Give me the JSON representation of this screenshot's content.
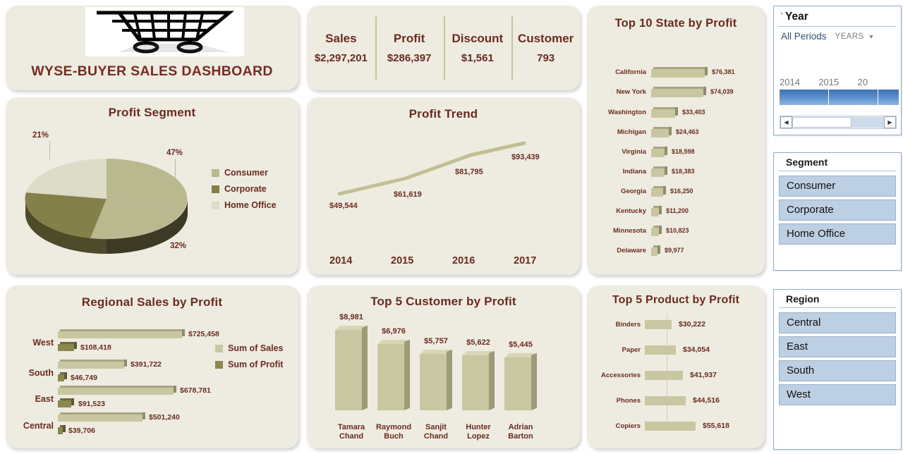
{
  "title_card": {
    "logo_icon": "shopping-cart-icon",
    "heading": "WYSE-BUYER SALES DASHBOARD"
  },
  "kpis": [
    {
      "label": "Sales",
      "value": "$2,297,201"
    },
    {
      "label": "Profit",
      "value": "$286,397"
    },
    {
      "label": "Discount",
      "value": "$1,561"
    },
    {
      "label": "Customer",
      "value": "793"
    }
  ],
  "colors": {
    "card_bg": "#eeece0",
    "title_text": "#6b2a22",
    "sales_series": "#c9c6a2",
    "profit_series": "#8a8750",
    "pie_consumer": "#b9b88f",
    "pie_corporate": "#84804a",
    "pie_home_office": "#dddcc9",
    "slicer_item": "#bdcfe3",
    "timeline_block": "#3f72b4"
  },
  "pie_card": {
    "title": "Profit Segment",
    "labels": [
      "47%",
      "32%",
      "21%"
    ],
    "legend": [
      "Consumer",
      "Corporate",
      "Home Office"
    ]
  },
  "trend_card": {
    "title": "Profit Trend",
    "x_labels": [
      "2014",
      "2015",
      "2016",
      "2017"
    ],
    "point_labels": [
      "$49,544",
      "$61,619",
      "$81,795",
      "$93,439"
    ]
  },
  "state_card": {
    "title": "Top 10 State by Profit",
    "rows": [
      {
        "name": "California",
        "value": "$76,381"
      },
      {
        "name": "New York",
        "value": "$74,039"
      },
      {
        "name": "Washington",
        "value": "$33,403"
      },
      {
        "name": "Michigan",
        "value": "$24,463"
      },
      {
        "name": "Virginia",
        "value": "$18,598"
      },
      {
        "name": "Indiana",
        "value": "$18,383"
      },
      {
        "name": "Georgia",
        "value": "$16,250"
      },
      {
        "name": "Kentucky",
        "value": "$11,200"
      },
      {
        "name": "Minnesota",
        "value": "$10,823"
      },
      {
        "name": "Delaware",
        "value": "$9,977"
      }
    ]
  },
  "region_card": {
    "title": "Regional Sales by Profit",
    "legend": [
      "Sum of Sales",
      "Sum of Profit"
    ],
    "rows": [
      {
        "name": "West",
        "sales": "$725,458",
        "profit": "$108,418"
      },
      {
        "name": "South",
        "sales": "$391,722",
        "profit": "$46,749"
      },
      {
        "name": "East",
        "sales": "$678,781",
        "profit": "$91,523"
      },
      {
        "name": "Central",
        "sales": "$501,240",
        "profit": "$39,706"
      }
    ]
  },
  "customer_card": {
    "title": "Top 5 Customer by Profit",
    "rows": [
      {
        "name1": "Tamara",
        "name2": "Chand",
        "value": "$8,981"
      },
      {
        "name1": "Raymond",
        "name2": "Buch",
        "value": "$6,976"
      },
      {
        "name1": "Sanjit",
        "name2": "Chand",
        "value": "$5,757"
      },
      {
        "name1": "Hunter",
        "name2": "Lopez",
        "value": "$5,622"
      },
      {
        "name1": "Adrian",
        "name2": "Barton",
        "value": "$5,445"
      }
    ]
  },
  "product_card": {
    "title": "Top 5 Product by Profit",
    "rows": [
      {
        "name": "Binders",
        "value": "$30,222"
      },
      {
        "name": "Paper",
        "value": "$34,054"
      },
      {
        "name": "Accessories",
        "value": "$41,937"
      },
      {
        "name": "Phones",
        "value": "$44,516"
      },
      {
        "name": "Copiers",
        "value": "$55,618"
      }
    ]
  },
  "year_slicer": {
    "title": "Year",
    "period_label": "All Periods",
    "level_label": "YEARS",
    "caret_icon": "chevron-down-icon",
    "years": [
      "2014",
      "2015",
      "20"
    ],
    "scroll_left_icon": "arrow-left-icon",
    "scroll_right_icon": "arrow-right-icon"
  },
  "segment_slicer": {
    "title": "Segment",
    "items": [
      "Consumer",
      "Corporate",
      "Home Office"
    ]
  },
  "region_slicer": {
    "title": "Region",
    "items": [
      "Central",
      "East",
      "South",
      "West"
    ]
  },
  "chart_data": [
    {
      "type": "pie",
      "title": "Profit Segment",
      "categories": [
        "Consumer",
        "Corporate",
        "Home Office"
      ],
      "values": [
        47,
        32,
        21
      ],
      "unit": "percent",
      "legend_position": "right",
      "three_d": true
    },
    {
      "type": "line",
      "title": "Profit Trend",
      "x": [
        "2014",
        "2015",
        "2016",
        "2017"
      ],
      "values": [
        49544,
        61619,
        81795,
        93439
      ],
      "xlabel": "",
      "ylabel": "",
      "grid": false,
      "data_labels": [
        "$49,544",
        "$61,619",
        "$81,795",
        "$93,439"
      ]
    },
    {
      "type": "bar",
      "orientation": "horizontal",
      "title": "Top 10 State by Profit",
      "categories": [
        "California",
        "New York",
        "Washington",
        "Michigan",
        "Virginia",
        "Indiana",
        "Georgia",
        "Kentucky",
        "Minnesota",
        "Delaware"
      ],
      "values": [
        76381,
        74039,
        33403,
        24463,
        18598,
        18383,
        16250,
        11200,
        10823,
        9977
      ],
      "xlabel": "",
      "ylabel": "",
      "grid": false
    },
    {
      "type": "bar",
      "orientation": "horizontal",
      "title": "Regional Sales by Profit",
      "categories": [
        "West",
        "South",
        "East",
        "Central"
      ],
      "series": [
        {
          "name": "Sum of Sales",
          "values": [
            725458,
            391722,
            678781,
            501240
          ]
        },
        {
          "name": "Sum of Profit",
          "values": [
            108418,
            46749,
            91523,
            39706
          ]
        }
      ],
      "legend_position": "right",
      "grid": false
    },
    {
      "type": "bar",
      "orientation": "vertical",
      "title": "Top 5 Customer by Profit",
      "categories": [
        "Tamara Chand",
        "Raymond Buch",
        "Sanjit Chand",
        "Hunter Lopez",
        "Adrian Barton"
      ],
      "values": [
        8981,
        6976,
        5757,
        5622,
        5445
      ],
      "grid": false
    },
    {
      "type": "bar",
      "orientation": "horizontal",
      "title": "Top 5 Product by Profit",
      "categories": [
        "Binders",
        "Paper",
        "Accessories",
        "Phones",
        "Copiers"
      ],
      "values": [
        30222,
        34054,
        41937,
        44516,
        55618
      ],
      "grid": false
    }
  ]
}
